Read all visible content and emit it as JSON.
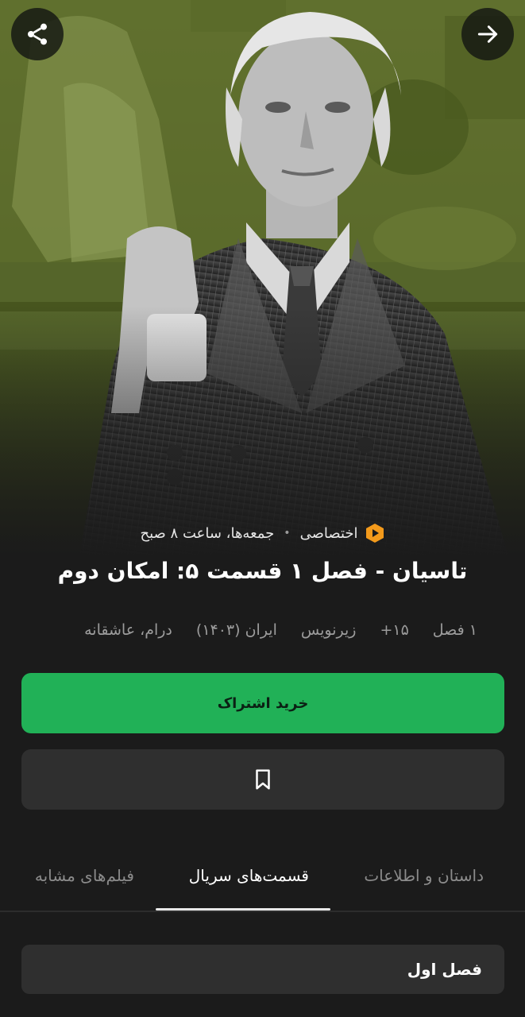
{
  "header": {
    "share_icon": "share-icon",
    "back_icon": "arrow-right-icon"
  },
  "meta": {
    "brand_icon": "play-logo-icon",
    "badge": "اختصاصی",
    "schedule": "جمعه‌ها، ساعت ۸ صبح"
  },
  "title": "تاسیان - فصل ۱ قسمت ۵: امکان دوم",
  "info": [
    "۱ فصل",
    "+۱۵",
    "زیرنویس",
    "ایران (۱۴۰۳)",
    "درام، عاشقانه"
  ],
  "actions": {
    "buy_label": "خرید اشتراک",
    "bookmark_icon": "bookmark-icon"
  },
  "tabs": [
    {
      "label": "داستان و اطلاعات",
      "active": false
    },
    {
      "label": "قسمت‌های سریال",
      "active": true
    },
    {
      "label": "فیلم‌های مشابه",
      "active": false
    }
  ],
  "season_label": "فصل اول",
  "colors": {
    "accent_green": "#21b157",
    "background": "#1b1b1b",
    "hero_tint": "#6a7a3a",
    "brand_orange": "#f39a1b"
  }
}
